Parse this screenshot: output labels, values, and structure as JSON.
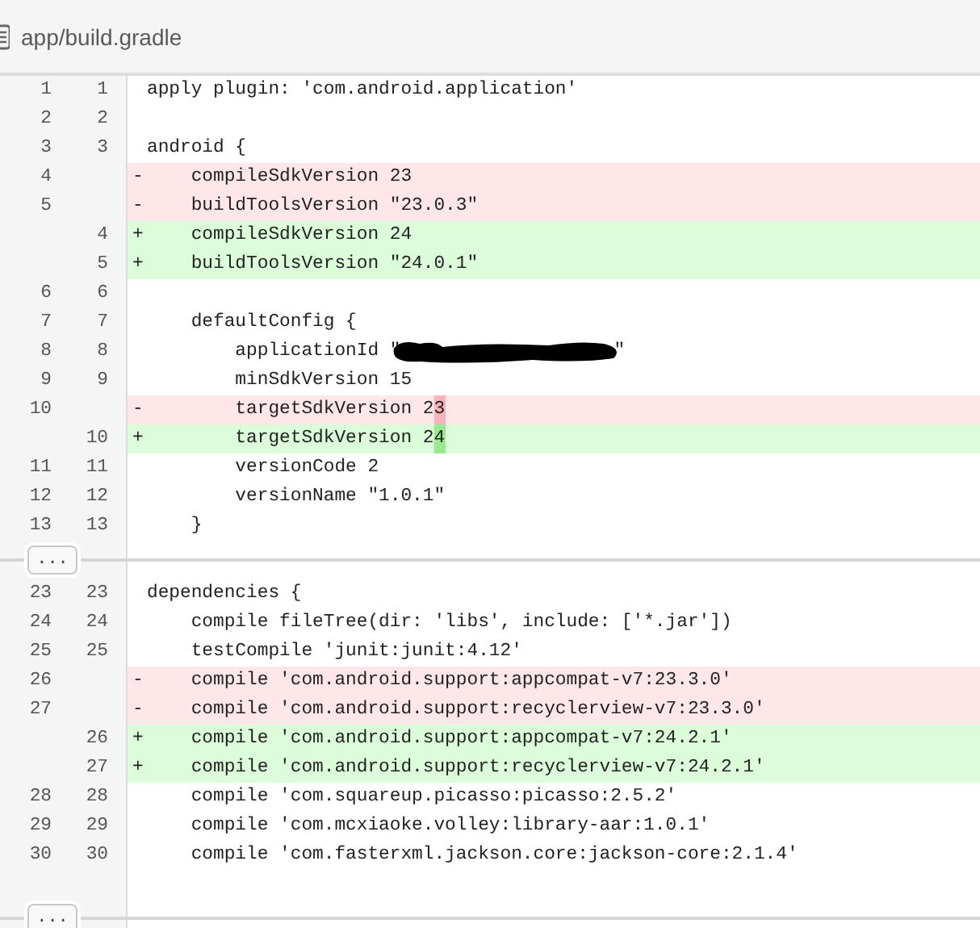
{
  "file": {
    "path": "app/build.gradle"
  },
  "hunks": [
    {
      "lines": [
        {
          "kind": "context",
          "old": "1",
          "new": "1",
          "code": "apply plugin: 'com.android.application'"
        },
        {
          "kind": "context",
          "old": "2",
          "new": "2"
        },
        {
          "kind": "context",
          "old": "3",
          "new": "3",
          "code": "android {"
        },
        {
          "kind": "deleted",
          "old": "4",
          "marker": "-",
          "code": "    compileSdkVersion 23"
        },
        {
          "kind": "deleted",
          "old": "5",
          "marker": "-",
          "code": "    buildToolsVersion \"23.0.3\""
        },
        {
          "kind": "added",
          "new": "4",
          "marker": "+",
          "code": "    compileSdkVersion 24"
        },
        {
          "kind": "added",
          "new": "5",
          "marker": "+",
          "code": "    buildToolsVersion \"24.0.1\""
        },
        {
          "kind": "context",
          "old": "6",
          "new": "6"
        },
        {
          "kind": "context",
          "old": "7",
          "new": "7",
          "code": "    defaultConfig {"
        },
        {
          "kind": "context",
          "old": "8",
          "new": "8",
          "code": "        applicationId \"",
          "redacted": true,
          "tail": "\""
        },
        {
          "kind": "context",
          "old": "9",
          "new": "9",
          "code": "        minSdkVersion 15"
        },
        {
          "kind": "deleted",
          "old": "10",
          "marker": "-",
          "code": "        targetSdkVersion 2",
          "changed": "3"
        },
        {
          "kind": "added",
          "new": "10",
          "marker": "+",
          "code": "        targetSdkVersion 2",
          "changed": "4"
        },
        {
          "kind": "context",
          "old": "11",
          "new": "11",
          "code": "        versionCode 2"
        },
        {
          "kind": "context",
          "old": "12",
          "new": "12",
          "code": "        versionName \"1.0.1\""
        },
        {
          "kind": "context",
          "old": "13",
          "new": "13",
          "code": "    }"
        }
      ],
      "expander": {
        "label": "..."
      }
    },
    {
      "lines": [
        {
          "kind": "context",
          "old": "23",
          "new": "23",
          "code": "dependencies {"
        },
        {
          "kind": "context",
          "old": "24",
          "new": "24",
          "code": "    compile fileTree(dir: 'libs', include: ['*.jar'])"
        },
        {
          "kind": "context",
          "old": "25",
          "new": "25",
          "code": "    testCompile 'junit:junit:4.12'"
        },
        {
          "kind": "deleted",
          "old": "26",
          "marker": "-",
          "code": "    compile 'com.android.support:appcompat-v7:23.3.0'"
        },
        {
          "kind": "deleted",
          "old": "27",
          "marker": "-",
          "code": "    compile 'com.android.support:recyclerview-v7:23.3.0'"
        },
        {
          "kind": "added",
          "new": "26",
          "marker": "+",
          "code": "    compile 'com.android.support:appcompat-v7:24.2.1'"
        },
        {
          "kind": "added",
          "new": "27",
          "marker": "+",
          "code": "    compile 'com.android.support:recyclerview-v7:24.2.1'"
        },
        {
          "kind": "context",
          "old": "28",
          "new": "28",
          "code": "    compile 'com.squareup.picasso:picasso:2.5.2'"
        },
        {
          "kind": "context",
          "old": "29",
          "new": "29",
          "code": "    compile 'com.mcxiaoke.volley:library-aar:1.0.1'"
        },
        {
          "kind": "context",
          "old": "30",
          "new": "30",
          "code": "    compile 'com.fasterxml.jackson.core:jackson-core:2.1.4'"
        }
      ],
      "expander": {
        "label": "..."
      }
    }
  ]
}
